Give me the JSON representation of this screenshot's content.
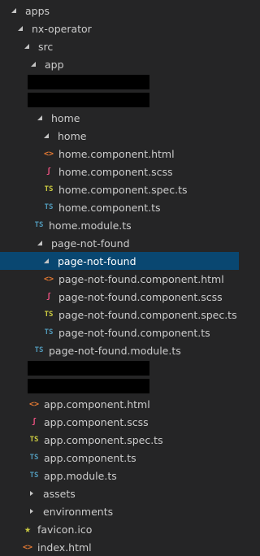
{
  "explorer": {
    "rows": [
      {
        "label": "apps",
        "kind": "folder-open"
      },
      {
        "label": "nx-operator",
        "kind": "folder-open"
      },
      {
        "label": "src",
        "kind": "folder-open"
      },
      {
        "label": "app",
        "kind": "folder-open"
      },
      {
        "label": "",
        "kind": "redacted"
      },
      {
        "label": "",
        "kind": "redacted"
      },
      {
        "label": "home",
        "kind": "folder-open"
      },
      {
        "label": "home",
        "kind": "folder-open"
      },
      {
        "label": "home.component.html",
        "kind": "html"
      },
      {
        "label": "home.component.scss",
        "kind": "scss"
      },
      {
        "label": "home.component.spec.ts",
        "kind": "tsspec"
      },
      {
        "label": "home.component.ts",
        "kind": "ts"
      },
      {
        "label": "home.module.ts",
        "kind": "ts"
      },
      {
        "label": "page-not-found",
        "kind": "folder-open"
      },
      {
        "label": "page-not-found",
        "kind": "folder-open",
        "selected": true
      },
      {
        "label": "page-not-found.component.html",
        "kind": "html"
      },
      {
        "label": "page-not-found.component.scss",
        "kind": "scss"
      },
      {
        "label": "page-not-found.component.spec.ts",
        "kind": "tsspec"
      },
      {
        "label": "page-not-found.component.ts",
        "kind": "ts"
      },
      {
        "label": "page-not-found.module.ts",
        "kind": "ts"
      },
      {
        "label": "",
        "kind": "redacted"
      },
      {
        "label": "",
        "kind": "redacted"
      },
      {
        "label": "app.component.html",
        "kind": "html"
      },
      {
        "label": "app.component.scss",
        "kind": "scss"
      },
      {
        "label": "app.component.spec.ts",
        "kind": "tsspec"
      },
      {
        "label": "app.component.ts",
        "kind": "ts"
      },
      {
        "label": "app.module.ts",
        "kind": "ts"
      },
      {
        "label": "assets",
        "kind": "folder-closed"
      },
      {
        "label": "environments",
        "kind": "folder-closed"
      },
      {
        "label": "favicon.ico",
        "kind": "star"
      },
      {
        "label": "index.html",
        "kind": "html"
      }
    ]
  },
  "icons": {
    "ts": "TS",
    "tsspec": "TS",
    "html": "<>",
    "scss": "ʃ",
    "star": "★"
  },
  "colors": {
    "background": "#252526",
    "selection": "#094771",
    "text": "#cccccc"
  }
}
